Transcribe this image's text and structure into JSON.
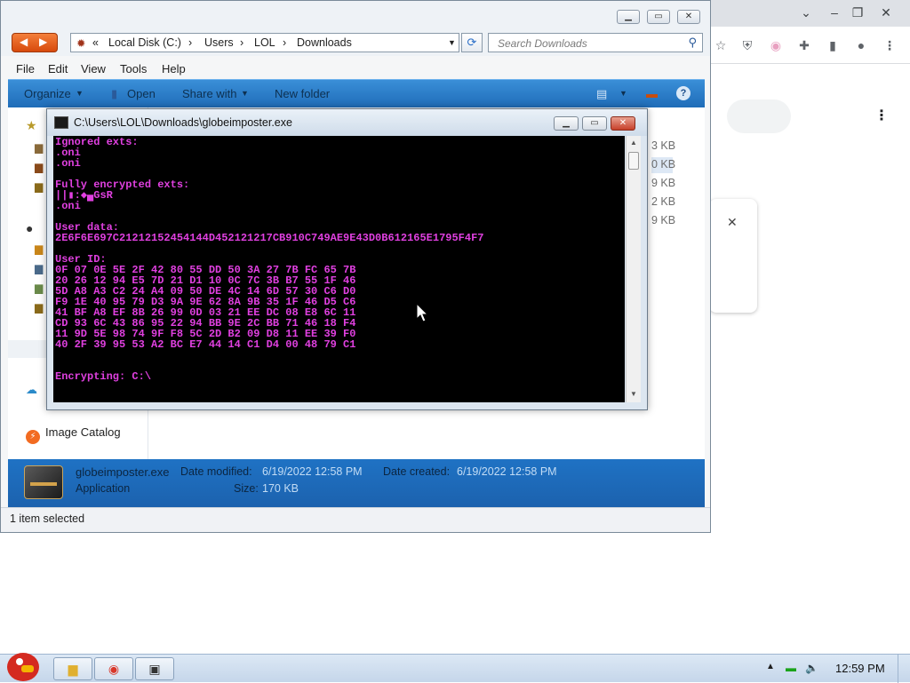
{
  "explorer": {
    "address": {
      "back_glyph": "«",
      "crumbs": [
        "Local Disk (C:)",
        "Users",
        "LOL",
        "Downloads"
      ]
    },
    "search": {
      "placeholder": "Search Downloads"
    },
    "menu": [
      "File",
      "Edit",
      "View",
      "Tools",
      "Help"
    ],
    "commands": {
      "organize": "Organize",
      "open": "Open",
      "share": "Share with",
      "new_folder": "New folder"
    },
    "sizes": [
      "3 KB",
      "0 KB",
      "9 KB",
      "2 KB",
      "9 KB"
    ],
    "nav_items": {
      "image_catalog": "Image Catalog"
    },
    "details": {
      "name": "globeimposter.exe",
      "type": "Application",
      "date_modified_label": "Date modified:",
      "date_modified": "6/19/2022 12:58 PM",
      "date_created_label": "Date created:",
      "date_created": "6/19/2022 12:58 PM",
      "size_label": "Size:",
      "size": "170 KB"
    },
    "status": "1 item selected"
  },
  "console": {
    "title": "C:\\Users\\LOL\\Downloads\\globeimposter.exe",
    "lines": [
      "Ignored exts:",
      ".oni",
      ".oni",
      "",
      "Fully encrypted exts:",
      "||▮:◆▄GsR",
      ".oni",
      "",
      "User data:",
      "2E6F6E697C21212152454144D452121217CB910C749AE9E43D0B612165E1795F4F7",
      "",
      "User ID:",
      "0F 07 0E 5E 2F 42 80 55 DD 50 3A 27 7B FC 65 7B",
      "20 26 12 94 E5 7D 21 D1 10 0C 7C 3B B7 55 1F 46",
      "5D A8 A3 C2 24 A4 09 50 DE 4C 14 6D 57 30 C6 D0",
      "F9 1E 40 95 79 D3 9A 9E 62 8A 9B 35 1F 46 D5 C6",
      "41 BF A8 EF 8B 26 99 0D 03 21 EE DC 08 E8 6C 11",
      "CD 93 6C 43 86 95 22 94 BB 9E 2C BB 71 46 18 F4",
      "11 9D 5E 98 74 9F F8 5C 2D B2 09 D8 11 EE 39 F0",
      "40 2F 39 95 53 A2 BC E7 44 14 C1 D4 00 48 79 C1",
      "",
      "",
      "Encrypting: C:\\"
    ],
    "text_color": "#e040e0"
  },
  "taskbar": {
    "clock": "12:59 PM"
  },
  "colors": {
    "accent": "#1f6cb8",
    "nav_orange": "#e65c18",
    "console_bg": "#000000"
  }
}
